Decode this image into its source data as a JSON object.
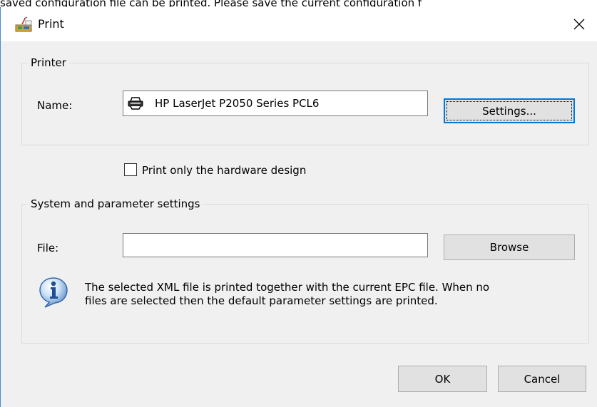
{
  "background": {
    "text": "saved configuration file can be printed.  Please save the current configuration f"
  },
  "window": {
    "title": "Print",
    "close_label": "×"
  },
  "printer": {
    "group_label": "Printer",
    "name_label": "Name:",
    "name_value": "HP LaserJet P2050 Series PCL6",
    "settings_button": "Settings..."
  },
  "hardware": {
    "checkbox_label": "Print only the hardware design",
    "checked": false
  },
  "system": {
    "group_label": "System and parameter settings",
    "file_label": "File:",
    "file_value": "",
    "browse_button": "Browse",
    "info_line1": "The selected XML file is printed together with the current EPC file. When no",
    "info_line2": "files are selected then the default parameter settings are printed."
  },
  "footer": {
    "ok_button": "OK",
    "cancel_button": "Cancel"
  },
  "colors": {
    "accent": "#0078d7",
    "dialog_bg": "#f0f0f0",
    "window_border": "#3c8ed8"
  },
  "icons": {
    "app": "print-app-icon",
    "close": "close-icon",
    "printer": "printer-icon",
    "info": "info-icon"
  }
}
